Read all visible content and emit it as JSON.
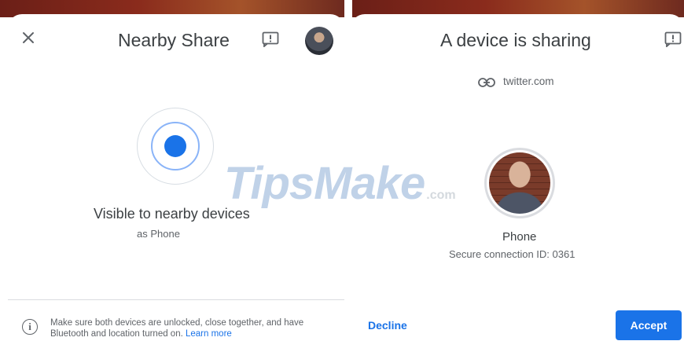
{
  "left_panel": {
    "title": "Nearby Share",
    "status": "Visible to nearby devices",
    "device_label": "as  Phone",
    "info_text": "Make sure both devices are unlocked, close together, and have Bluetooth and location turned on.",
    "learn_more": "Learn more"
  },
  "right_panel": {
    "title": "A device is sharing",
    "link": "twitter.com",
    "device_name": "Phone",
    "secure_connection": "Secure connection ID: 0361",
    "decline_label": "Decline",
    "accept_label": "Accept"
  },
  "watermark": {
    "main": "TipsMake",
    "suffix": ".com"
  },
  "icons": {
    "close": "close-icon",
    "feedback": "feedback-icon",
    "link": "link-icon",
    "info": "info-icon"
  },
  "colors": {
    "accent": "#1a73e8",
    "pulse_ring": "#8ab4f8",
    "text_primary": "#3c4043",
    "text_secondary": "#5f6368"
  }
}
